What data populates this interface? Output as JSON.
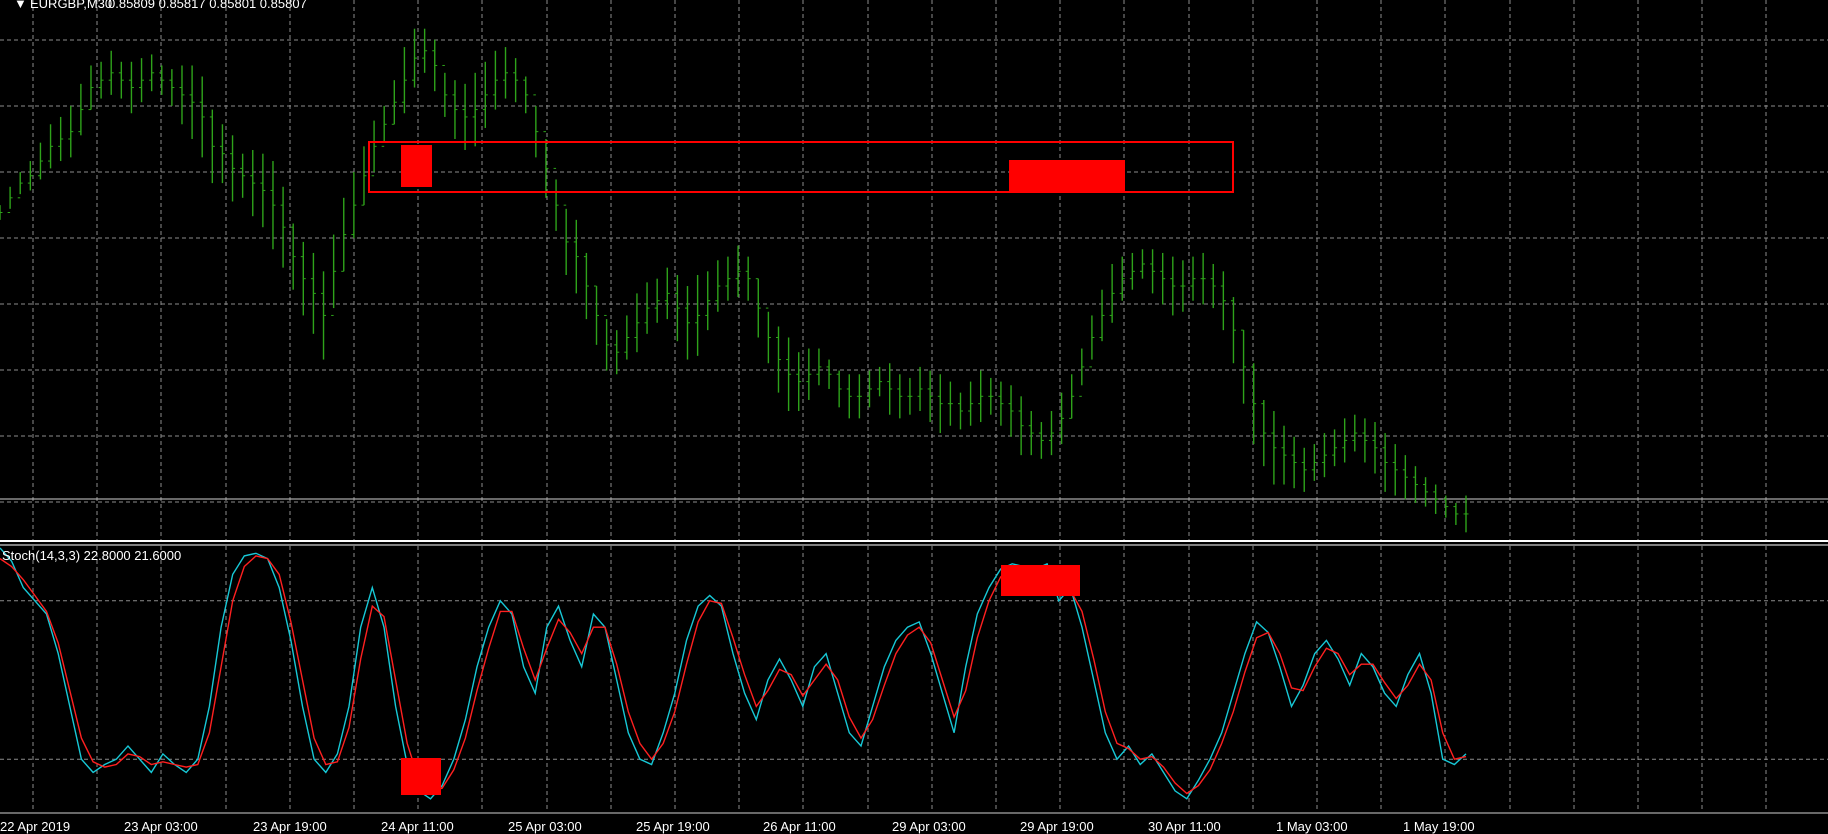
{
  "header": {
    "symbol_label": "EURGBP,M30",
    "ohlc_label": "0.85809 0.85817 0.85801 0.85807",
    "indicator_label": "Stoch(14,3,3) 22.8000 21.6000"
  },
  "colors": {
    "background": "#000000",
    "grid": "#8c8c8c",
    "bars": "#2ea31a",
    "stoch_main": "#17c8d6",
    "stoch_signal": "#ff2020",
    "highlight": "#ff0000",
    "separator": "#ffffff"
  },
  "chart_data": [
    {
      "type": "ohlc",
      "title": "EURGBP,M30",
      "x_tick_labels": [
        "22 Apr 2019",
        "23 Apr 03:00",
        "23 Apr 19:00",
        "24 Apr 11:00",
        "25 Apr 03:00",
        "25 Apr 19:00",
        "26 Apr 11:00",
        "29 Apr 03:00",
        "29 Apr 19:00",
        "30 Apr 11:00",
        "1 May 03:00",
        "1 May 19:00"
      ],
      "x_range": [
        0,
        190
      ],
      "y_range": [
        0.8578,
        0.8649
      ],
      "grid": true,
      "close": [
        0.8622,
        0.8624,
        0.8626,
        0.8627,
        0.8629,
        0.8631,
        0.8632,
        0.8633,
        0.8636,
        0.8639,
        0.864,
        0.8641,
        0.864,
        0.8639,
        0.864,
        0.8641,
        0.864,
        0.8639,
        0.8638,
        0.8637,
        0.8635,
        0.8631,
        0.863,
        0.8628,
        0.8627,
        0.8626,
        0.8625,
        0.8623,
        0.862,
        0.8616,
        0.8613,
        0.8611,
        0.8608,
        0.8614,
        0.8619,
        0.8623,
        0.8627,
        0.8631,
        0.8634,
        0.8637,
        0.864,
        0.8643,
        0.8644,
        0.8642,
        0.8638,
        0.8636,
        0.8635,
        0.8636,
        0.8638,
        0.864,
        0.8641,
        0.864,
        0.8638,
        0.8633,
        0.8628,
        0.8623,
        0.8618,
        0.8616,
        0.8612,
        0.8608,
        0.8604,
        0.8603,
        0.8605,
        0.8607,
        0.8609,
        0.861,
        0.8611,
        0.8609,
        0.8607,
        0.8608,
        0.861,
        0.8612,
        0.8613,
        0.8614,
        0.8613,
        0.8609,
        0.8605,
        0.8602,
        0.86,
        0.8599,
        0.86,
        0.8601,
        0.86,
        0.8598,
        0.8597,
        0.8597,
        0.8598,
        0.8599,
        0.8598,
        0.8597,
        0.8597,
        0.8598,
        0.8597,
        0.8596,
        0.8596,
        0.8595,
        0.8596,
        0.8597,
        0.8597,
        0.8596,
        0.8595,
        0.8593,
        0.8592,
        0.8591,
        0.8592,
        0.8594,
        0.8597,
        0.8601,
        0.8605,
        0.8608,
        0.8611,
        0.8613,
        0.8614,
        0.8615,
        0.8614,
        0.8613,
        0.8612,
        0.8612,
        0.8613,
        0.8613,
        0.8612,
        0.861,
        0.8606,
        0.8601,
        0.8596,
        0.8592,
        0.859,
        0.8589,
        0.8588,
        0.8587,
        0.8588,
        0.8589,
        0.859,
        0.8591,
        0.8592,
        0.8591,
        0.859,
        0.8588,
        0.8587,
        0.8586,
        0.8585,
        0.8584,
        0.8583,
        0.8582,
        0.8581,
        0.8581
      ],
      "bar_range": [
        0.0002,
        0.0003,
        0.0003,
        0.0004,
        0.0005,
        0.0006,
        0.0006,
        0.0007,
        0.0007,
        0.0006,
        0.0005,
        0.0006,
        0.0005,
        0.0007,
        0.0006,
        0.0005,
        0.0004,
        0.0005,
        0.0008,
        0.001,
        0.0011,
        0.001,
        0.0008,
        0.0009,
        0.0006,
        0.0009,
        0.001,
        0.0012,
        0.0011,
        0.0009,
        0.001,
        0.0011,
        0.0012,
        0.001,
        0.001,
        0.0009,
        0.0008,
        0.0007,
        0.0005,
        0.0006,
        0.0009,
        0.0008,
        0.0006,
        0.0007,
        0.0006,
        0.0008,
        0.0009,
        0.001,
        0.0009,
        0.0008,
        0.0007,
        0.0006,
        0.0005,
        0.0007,
        0.0008,
        0.0007,
        0.0009,
        0.001,
        0.0009,
        0.0008,
        0.0007,
        0.0006,
        0.0006,
        0.0008,
        0.0007,
        0.0006,
        0.0007,
        0.0009,
        0.001,
        0.0011,
        0.0008,
        0.0007,
        0.0006,
        0.0007,
        0.0006,
        0.0008,
        0.0007,
        0.0009,
        0.001,
        0.0008,
        0.0007,
        0.0005,
        0.0004,
        0.0005,
        0.0006,
        0.0006,
        0.0005,
        0.0004,
        0.0007,
        0.0006,
        0.0005,
        0.0006,
        0.0007,
        0.0008,
        0.0006,
        0.0005,
        0.0006,
        0.0007,
        0.0005,
        0.0006,
        0.0007,
        0.0008,
        0.0006,
        0.0005,
        0.0006,
        0.0007,
        0.0006,
        0.0005,
        0.0006,
        0.0007,
        0.0008,
        0.0006,
        0.0005,
        0.0004,
        0.0006,
        0.0007,
        0.0008,
        0.0007,
        0.0006,
        0.0007,
        0.0006,
        0.0008,
        0.0009,
        0.001,
        0.0011,
        0.0009,
        0.001,
        0.0008,
        0.0007,
        0.0006,
        0.0005,
        0.0006,
        0.0005,
        0.0006,
        0.0005,
        0.0006,
        0.0007,
        0.0008,
        0.0007,
        0.0006,
        0.0005,
        0.0004,
        0.0004,
        0.0003,
        0.0003
      ]
    },
    {
      "type": "line",
      "title": "Stoch(14,3,3) 22.8000 21.6000",
      "y_range": [
        0,
        100
      ],
      "grid": true,
      "levels": [
        80,
        20
      ],
      "series": [
        {
          "name": "main",
          "values": [
            100,
            95,
            85,
            80,
            75,
            60,
            40,
            20,
            15,
            18,
            20,
            25,
            20,
            15,
            22,
            18,
            15,
            20,
            40,
            70,
            90,
            97,
            98,
            96,
            85,
            65,
            40,
            20,
            15,
            22,
            40,
            70,
            85,
            70,
            40,
            18,
            8,
            5,
            10,
            20,
            35,
            55,
            70,
            80,
            75,
            55,
            45,
            70,
            78,
            65,
            55,
            75,
            70,
            50,
            30,
            20,
            18,
            30,
            45,
            65,
            78,
            82,
            78,
            60,
            45,
            35,
            50,
            58,
            50,
            40,
            55,
            60,
            45,
            30,
            25,
            40,
            55,
            65,
            70,
            72,
            60,
            45,
            30,
            55,
            75,
            85,
            92,
            94,
            93,
            92,
            94,
            80,
            85,
            70,
            50,
            30,
            20,
            25,
            18,
            22,
            15,
            8,
            5,
            12,
            20,
            30,
            45,
            60,
            72,
            68,
            55,
            40,
            48,
            60,
            65,
            58,
            48,
            60,
            55,
            45,
            40,
            52,
            60,
            45,
            20,
            18,
            22
          ]
        },
        {
          "name": "signal",
          "values": [
            96,
            93,
            88,
            82,
            76,
            64,
            46,
            28,
            19,
            17,
            18,
            22,
            21,
            18,
            19,
            18,
            17,
            18,
            30,
            55,
            80,
            93,
            97,
            96,
            90,
            72,
            50,
            28,
            18,
            19,
            32,
            58,
            78,
            74,
            50,
            26,
            12,
            8,
            9,
            16,
            28,
            46,
            62,
            76,
            76,
            62,
            50,
            62,
            73,
            68,
            60,
            70,
            70,
            56,
            38,
            26,
            20,
            26,
            38,
            56,
            72,
            80,
            79,
            66,
            52,
            40,
            46,
            54,
            52,
            44,
            50,
            56,
            50,
            36,
            28,
            35,
            48,
            60,
            67,
            70,
            64,
            50,
            36,
            46,
            66,
            80,
            89,
            93,
            93,
            92,
            93,
            85,
            84,
            76,
            58,
            38,
            26,
            24,
            20,
            21,
            17,
            11,
            7,
            10,
            16,
            26,
            38,
            53,
            66,
            68,
            60,
            47,
            46,
            55,
            62,
            60,
            52,
            56,
            56,
            49,
            43,
            48,
            56,
            50,
            30,
            20,
            21
          ]
        }
      ]
    }
  ]
}
